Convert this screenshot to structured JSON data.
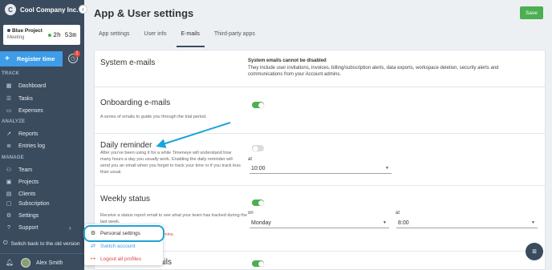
{
  "app": {
    "brand_initial": "C",
    "company": "Cool Company Inc.",
    "collapse_glyph": "‹"
  },
  "timer": {
    "project": "Blue Project",
    "task": "Meeting",
    "elapsed": "2h 53m"
  },
  "register": {
    "label": "Register time",
    "plus": "+",
    "notification_count": "1",
    "notif_icon": "clock-icon"
  },
  "sidebar": {
    "sections": {
      "track": "TRACK",
      "analyze": "ANALYZE",
      "manage": "MANAGE"
    },
    "items": [
      {
        "id": "dashboard",
        "label": "Dashboard",
        "icon": "dashboard-icon",
        "glyph": "▦"
      },
      {
        "id": "tasks",
        "label": "Tasks",
        "icon": "tasks-icon",
        "glyph": "☰"
      },
      {
        "id": "expenses",
        "label": "Expenses",
        "icon": "expenses-icon",
        "glyph": "▭"
      },
      {
        "id": "reports",
        "label": "Reports",
        "icon": "reports-icon",
        "glyph": "↗"
      },
      {
        "id": "entries-log",
        "label": "Entries log",
        "icon": "entries-log-icon",
        "glyph": "≣"
      },
      {
        "id": "team",
        "label": "Team",
        "icon": "team-icon",
        "glyph": "⚇"
      },
      {
        "id": "projects",
        "label": "Projects",
        "icon": "projects-icon",
        "glyph": "▣"
      },
      {
        "id": "clients",
        "label": "Clients",
        "icon": "clients-icon",
        "glyph": "▤"
      },
      {
        "id": "subscription",
        "label": "Subscription",
        "icon": "subscription-icon",
        "glyph": "▢"
      },
      {
        "id": "settings",
        "label": "Settings",
        "icon": "gear-icon",
        "glyph": "⚙"
      },
      {
        "id": "support",
        "label": "Support",
        "icon": "support-icon",
        "glyph": "?"
      }
    ],
    "support_chevron": "›",
    "switch_back": "Switch back to the old version",
    "switch_back_glyph": "⏻",
    "user_name": "Alex Smith",
    "bell_glyph": "♫"
  },
  "header": {
    "title": "App & User settings",
    "save_label": "Save"
  },
  "tabs": [
    {
      "id": "app-settings",
      "label": "App settings",
      "active": false
    },
    {
      "id": "user-info",
      "label": "User info",
      "active": false
    },
    {
      "id": "emails",
      "label": "E-mails",
      "active": true
    },
    {
      "id": "third-party-apps",
      "label": "Third-party apps",
      "active": false
    }
  ],
  "sections": {
    "system": {
      "title": "System e-mails",
      "note_strong": "System emails cannot be disabled",
      "note_text": "They include user invitations, invoices, billing/subscription alerts, data exports, workspace deletion, security alerts and communications from your Account admins."
    },
    "onboarding": {
      "title": "Onboarding e-mails",
      "description": "A series of emails to guide you through the trial period.",
      "enabled": true
    },
    "daily": {
      "title": "Daily reminder",
      "description": "After you've been using it for a while Timeneye will understand how many hours a day you usually work. Enabling the daily reminder will send you an email when you forget to track your time or if you track less than usual.",
      "enabled": false,
      "at_label": "at",
      "time": "10:00"
    },
    "weekly": {
      "title": "Weekly status",
      "description": "Receive a status report email to see what your team has tracked during the last week.",
      "enabled": true,
      "on_label": "on",
      "day": "Monday",
      "at_label": "at",
      "time": "8:00",
      "red_fragment": "mins."
    },
    "partial": {
      "title_fragment": "ails",
      "enabled": true
    }
  },
  "popup": {
    "items": [
      {
        "id": "personal-settings",
        "label": "Personal settings",
        "icon": "user-settings-icon",
        "glyph": "⚙",
        "color": "#333333"
      },
      {
        "id": "switch-account",
        "label": "Switch account",
        "icon": "switch-icon",
        "glyph": "⇄",
        "color": "#3e9ce8"
      },
      {
        "id": "logout-all",
        "label": "Logout all profiles",
        "icon": "logout-icon",
        "glyph": "↦",
        "color": "#e04545"
      }
    ]
  },
  "chat": {
    "glyph": "≡"
  },
  "colors": {
    "accent": "#3e9ce8",
    "success": "#4caf50",
    "sidebar": "#3a4b5e",
    "danger": "#e04545",
    "annotation": "#1fa3d8"
  },
  "caret": "▼"
}
